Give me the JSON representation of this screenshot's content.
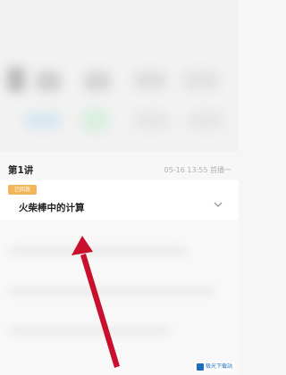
{
  "lesson": {
    "title": "第1讲",
    "meta": "05-16 13:55 首播一"
  },
  "card": {
    "tag": "已回放",
    "topic": "火柴棒中的计算"
  },
  "watermark": "极光下载站",
  "icons": {
    "chevron": "chevron-down-icon",
    "arrow": "red-arrow-annotation"
  },
  "colors": {
    "tag": "#f3b55a",
    "arrow": "#c8102e",
    "watermark": "#1f6fbf"
  }
}
